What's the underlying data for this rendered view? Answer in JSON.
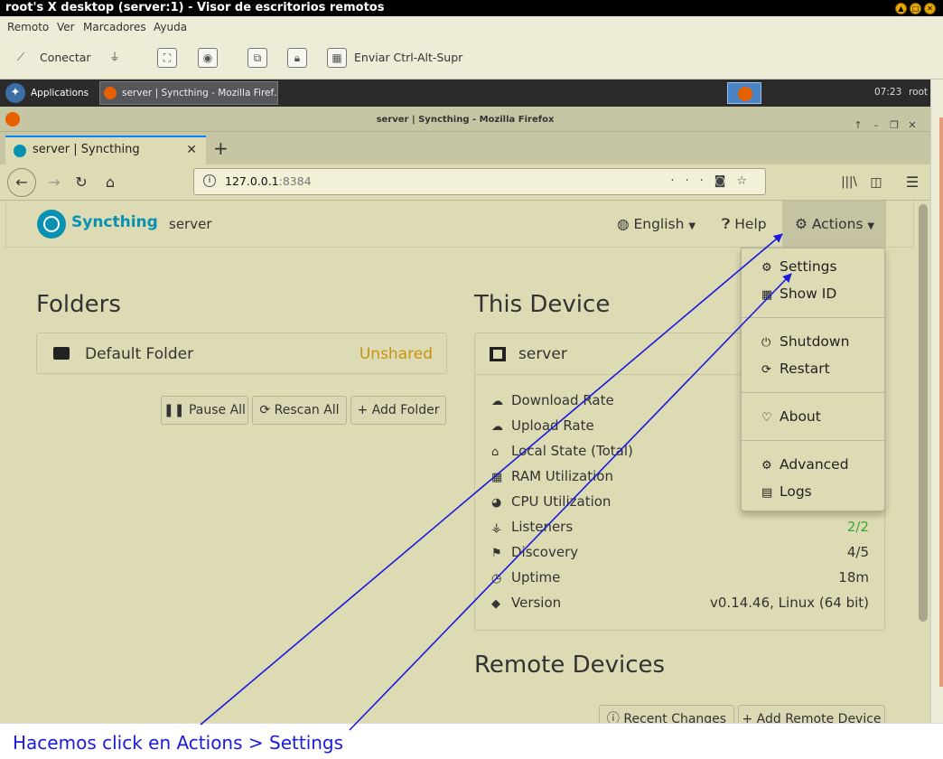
{
  "outer_window": {
    "title": "root's X desktop (server:1) - Visor de escritorios remotos",
    "menu": [
      "Remoto",
      "Ver",
      "Marcadores",
      "Ayuda"
    ],
    "toolbar": {
      "connect_label": "Conectar",
      "send_keys_label": "Enviar Ctrl-Alt-Supr"
    }
  },
  "panel": {
    "apps_label": "Applications",
    "task_label": "server | Syncthing - Mozilla Firef…",
    "clock": "07:23",
    "user": "root"
  },
  "firefox": {
    "window_title": "server | Syncthing - Mozilla Firefox",
    "tab_title": "server | Syncthing",
    "url_host": "127.0.0.1",
    "url_port": ":8384"
  },
  "syncthing": {
    "brand": "Syncthing",
    "device_name": "server",
    "nav": {
      "language": "English",
      "help": "Help",
      "actions": "Actions"
    },
    "actions_menu": {
      "settings": "Settings",
      "show_id": "Show ID",
      "shutdown": "Shutdown",
      "restart": "Restart",
      "about": "About",
      "advanced": "Advanced",
      "logs": "Logs"
    },
    "folders": {
      "heading": "Folders",
      "items": [
        {
          "name": "Default Folder",
          "status": "Unshared"
        }
      ],
      "buttons": {
        "pause_all": "Pause All",
        "rescan_all": "Rescan All",
        "add_folder": "Add Folder"
      }
    },
    "this_device": {
      "heading": "This Device",
      "name": "server",
      "stats": [
        {
          "label": "Download Rate",
          "value": ""
        },
        {
          "label": "Upload Rate",
          "value": ""
        },
        {
          "label": "Local State (Total)",
          "value": ""
        },
        {
          "label": "RAM Utilization",
          "value": ""
        },
        {
          "label": "CPU Utilization",
          "value": ""
        },
        {
          "label": "Listeners",
          "value": "2/2"
        },
        {
          "label": "Discovery",
          "value": "4/5"
        },
        {
          "label": "Uptime",
          "value": "18m"
        },
        {
          "label": "Version",
          "value": "v0.14.46, Linux (64 bit)"
        }
      ]
    },
    "remote_devices": {
      "heading": "Remote Devices",
      "buttons": {
        "recent_changes": "Recent Changes",
        "add_remote": "Add Remote Device"
      }
    }
  },
  "colors": {
    "accent": "#0891b2",
    "unshared": "#c89212",
    "listeners_ok": "#3aa63a",
    "caption": "#1a1adf"
  },
  "caption": "Hacemos click en Actions > Settings"
}
